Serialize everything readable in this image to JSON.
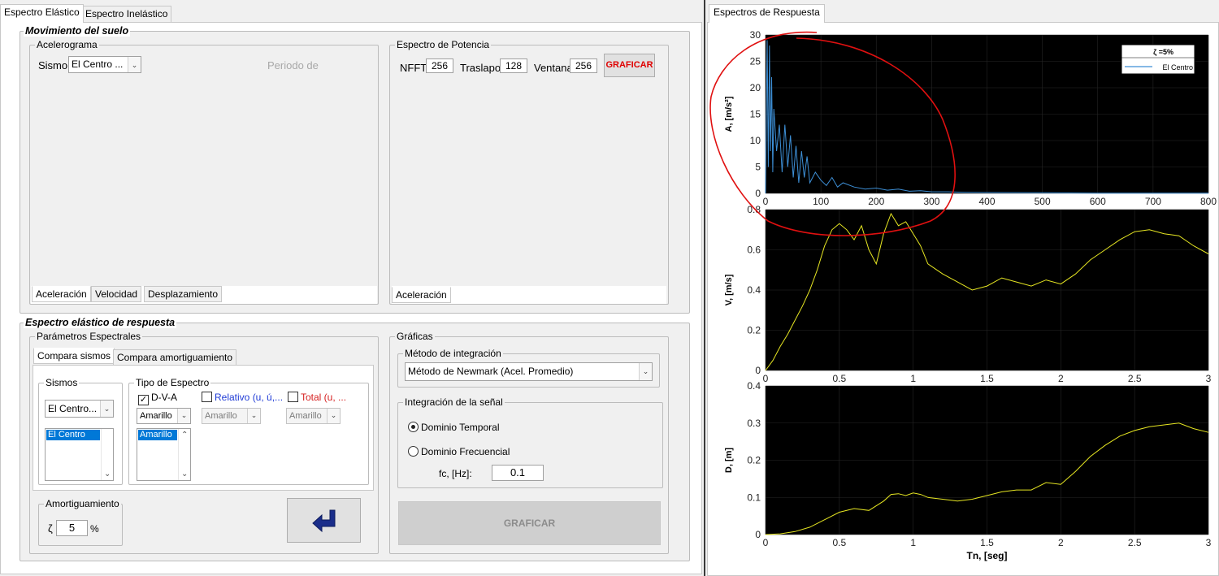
{
  "left_tabs": [
    "Espectro Elástico",
    "Espectro Inelástico"
  ],
  "right_tabs": [
    "Espectros de Respuesta"
  ],
  "movimiento": {
    "title": "Movimiento del suelo",
    "acelerograma": {
      "title": "Acelerograma",
      "sismo_label": "Sismo",
      "sismo_value": "El Centro ...",
      "periodo_label": "Periodo de",
      "tabs": [
        "Aceleración",
        "Velocidad",
        "Desplazamiento"
      ]
    },
    "potencia": {
      "title": "Espectro de Potencia",
      "nfft_label": "NFFT",
      "nfft_value": "256",
      "traslapo_label": "Traslapo",
      "traslapo_value": "128",
      "ventana_label": "Ventana",
      "ventana_value": "256",
      "graficar": "GRAFICAR",
      "tabs": [
        "Aceleración"
      ]
    }
  },
  "espectro": {
    "title": "Espectro elástico de respuesta",
    "parametros": {
      "title": "Parámetros Espectrales",
      "tabs": [
        "Compara sismos",
        "Compara amortiguamiento"
      ],
      "sismos_title": "Sismos",
      "sismos_select": "El Centro...",
      "sismos_list": [
        "El Centro"
      ],
      "tipo_title": "Tipo de Espectro",
      "dva_label": "D-V-A",
      "dva_color": "Amarillo",
      "dva_list": [
        "Amarillo"
      ],
      "relativo_label": "Relativo (u, ú,...",
      "relativo_color": "Amarillo",
      "total_label": "Total (u, ...",
      "total_color": "Amarillo",
      "amort_title": "Amortiguamiento",
      "zeta_symbol": "ζ",
      "zeta_value": "5",
      "zeta_unit": "%"
    },
    "graficas": {
      "title": "Gráficas",
      "metodo_title": "Método de integración",
      "metodo_value": "Método de Newmark (Acel. Promedio)",
      "integracion_title": "Integración de la señal",
      "temporal_label": "Dominio Temporal",
      "frecuencial_label": "Dominio Frecuencial",
      "fc_label": "fc, [Hz]:",
      "fc_value": "0.1",
      "graficar": "GRAFICAR"
    }
  },
  "colors": {
    "plot_bg": "#000000",
    "series_blue": "#3d8fd6",
    "series_yellow": "#e6e622",
    "annotation_red": "#e01010",
    "graficar_red": "#e00000",
    "relativo_blue": "#1f3bd6",
    "total_red": "#d61f1f"
  },
  "chart_data": [
    {
      "type": "line",
      "ylabel": "A, [m/s²]",
      "xlim": [
        0,
        800
      ],
      "ylim": [
        0,
        30
      ],
      "xticks": [
        "0",
        "100",
        "200",
        "300",
        "400",
        "500",
        "600",
        "700",
        "800"
      ],
      "yticks": [
        "0",
        "5",
        "10",
        "15",
        "20",
        "25",
        "30"
      ],
      "legend_title": "ζ =5%",
      "legend_position": "top-right",
      "series": [
        {
          "name": "El Centro",
          "x": [
            0,
            3,
            5,
            7,
            9,
            11,
            13,
            15,
            20,
            25,
            30,
            35,
            40,
            45,
            50,
            55,
            60,
            65,
            70,
            75,
            80,
            90,
            100,
            110,
            120,
            130,
            140,
            160,
            180,
            200,
            220,
            240,
            260,
            280,
            300,
            330,
            360,
            400,
            500,
            600,
            700,
            800
          ],
          "y": [
            0,
            29,
            5,
            28,
            8,
            22,
            4,
            16,
            8,
            13,
            4,
            13,
            5,
            11,
            3,
            9,
            2,
            8,
            3,
            7,
            2,
            4,
            2.5,
            1.5,
            3,
            1.2,
            2,
            1.2,
            0.8,
            1,
            0.6,
            0.8,
            0.4,
            0.5,
            0.3,
            0.3,
            0.2,
            0.15,
            0.1,
            0.05,
            0.05,
            0.05
          ]
        }
      ]
    },
    {
      "type": "line",
      "ylabel": "V, [m/s]",
      "xlim": [
        0,
        3
      ],
      "ylim": [
        0,
        0.8
      ],
      "xticks": [
        "0",
        "0.5",
        "1",
        "1.5",
        "2",
        "2.5",
        "3"
      ],
      "yticks": [
        "0",
        "0.2",
        "0.4",
        "0.6",
        "0.8"
      ],
      "series": [
        {
          "x": [
            0,
            0.05,
            0.1,
            0.15,
            0.2,
            0.25,
            0.3,
            0.35,
            0.4,
            0.45,
            0.5,
            0.55,
            0.6,
            0.65,
            0.7,
            0.75,
            0.8,
            0.85,
            0.9,
            0.95,
            1.0,
            1.05,
            1.1,
            1.2,
            1.3,
            1.4,
            1.5,
            1.6,
            1.7,
            1.8,
            1.9,
            2.0,
            2.1,
            2.2,
            2.3,
            2.4,
            2.5,
            2.6,
            2.7,
            2.8,
            2.9,
            3.0
          ],
          "y": [
            0,
            0.05,
            0.12,
            0.18,
            0.25,
            0.32,
            0.4,
            0.5,
            0.62,
            0.7,
            0.73,
            0.7,
            0.65,
            0.72,
            0.6,
            0.53,
            0.68,
            0.78,
            0.72,
            0.74,
            0.68,
            0.62,
            0.53,
            0.48,
            0.44,
            0.4,
            0.42,
            0.46,
            0.44,
            0.42,
            0.45,
            0.43,
            0.48,
            0.55,
            0.6,
            0.65,
            0.69,
            0.7,
            0.68,
            0.67,
            0.62,
            0.58
          ]
        }
      ]
    },
    {
      "type": "line",
      "ylabel": "D, [m]",
      "xlabel": "Tn, [seg]",
      "xlim": [
        0,
        3
      ],
      "ylim": [
        0,
        0.4
      ],
      "xticks": [
        "0",
        "0.5",
        "1",
        "1.5",
        "2",
        "2.5",
        "3"
      ],
      "yticks": [
        "0",
        "0.1",
        "0.2",
        "0.3",
        "0.4"
      ],
      "series": [
        {
          "x": [
            0,
            0.1,
            0.2,
            0.3,
            0.4,
            0.5,
            0.6,
            0.7,
            0.8,
            0.85,
            0.9,
            0.95,
            1.0,
            1.05,
            1.1,
            1.2,
            1.3,
            1.4,
            1.5,
            1.6,
            1.7,
            1.8,
            1.9,
            2.0,
            2.1,
            2.2,
            2.3,
            2.4,
            2.5,
            2.6,
            2.7,
            2.8,
            2.9,
            3.0
          ],
          "y": [
            0,
            0.002,
            0.008,
            0.02,
            0.04,
            0.06,
            0.07,
            0.065,
            0.09,
            0.108,
            0.11,
            0.105,
            0.112,
            0.108,
            0.1,
            0.095,
            0.09,
            0.095,
            0.105,
            0.115,
            0.12,
            0.12,
            0.14,
            0.135,
            0.17,
            0.21,
            0.24,
            0.265,
            0.28,
            0.29,
            0.295,
            0.3,
            0.285,
            0.275
          ]
        }
      ]
    }
  ]
}
